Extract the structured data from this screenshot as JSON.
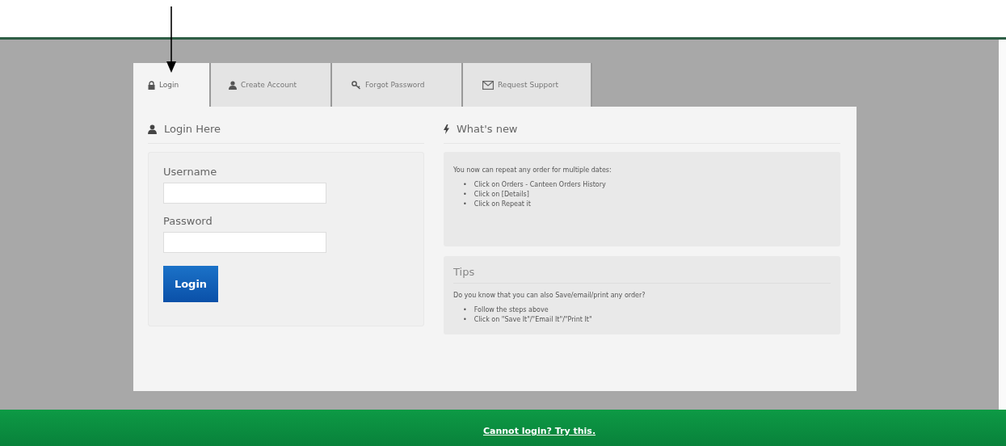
{
  "tabs": [
    {
      "label": "Login",
      "selected": true
    },
    {
      "label": "Create Account",
      "selected": false
    },
    {
      "label": "Forgot Password",
      "selected": false
    },
    {
      "label": "Request Support",
      "selected": false
    }
  ],
  "login": {
    "heading": "Login Here",
    "fields": [
      {
        "label": "Username"
      },
      {
        "label": "Password"
      }
    ],
    "button": "Login"
  },
  "whats_new": {
    "heading": "What's new",
    "intro": "You now can repeat any order for multiple dates:",
    "items": [
      {
        "marker": "•",
        "text": "Click on Orders - Canteen Orders History"
      },
      {
        "marker": "•",
        "text": "Click on [Details]"
      },
      {
        "marker": "•",
        "text": "Click on Repeat it"
      }
    ]
  },
  "tips": {
    "heading": "Tips",
    "intro": "Do you know that you can also Save/email/print any order?",
    "items": [
      {
        "marker": "•",
        "text": "Follow the steps above"
      },
      {
        "marker": "•",
        "text": "Click on \"Save It\"/\"Email It\"/\"Print It\""
      }
    ]
  },
  "footer": {
    "link": "Cannot login? Try this."
  }
}
